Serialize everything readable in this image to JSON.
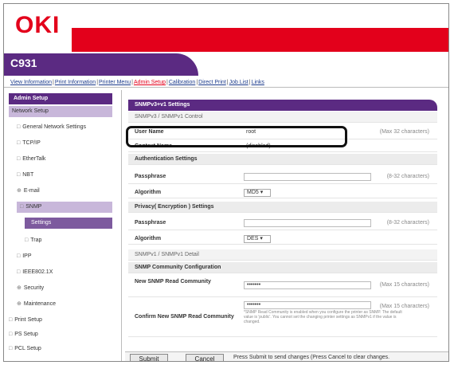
{
  "header": {
    "logo": "OKI",
    "model": "C931"
  },
  "topnav": {
    "items": [
      {
        "label": "View Information"
      },
      {
        "label": "Print Information"
      },
      {
        "label": "Printer Menu"
      },
      {
        "label": "Admin Setup"
      },
      {
        "label": "Calibration"
      },
      {
        "label": "Direct Print"
      },
      {
        "label": "Job List"
      },
      {
        "label": "Links"
      }
    ],
    "sep": "|"
  },
  "sidebar": {
    "title": "Admin Setup",
    "items": [
      {
        "label": "Network Setup"
      },
      {
        "label": "General Network Settings",
        "pre": "□"
      },
      {
        "label": "TCP/IP",
        "pre": "□"
      },
      {
        "label": "EtherTalk",
        "pre": "□"
      },
      {
        "label": "NBT",
        "pre": "□"
      },
      {
        "label": "E-mail",
        "pre": "⊕"
      },
      {
        "label": "SNMP",
        "pre": "□"
      },
      {
        "label": "Settings",
        "pre": ""
      },
      {
        "label": "Trap",
        "pre": "□"
      },
      {
        "label": "IPP",
        "pre": "□"
      },
      {
        "label": "IEEE802.1X",
        "pre": "□"
      },
      {
        "label": "Security",
        "pre": "⊕"
      },
      {
        "label": "Maintenance",
        "pre": "⊕"
      },
      {
        "label": "Print Setup",
        "pre": "□"
      },
      {
        "label": "PS Setup",
        "pre": "□"
      },
      {
        "label": "PCL Setup",
        "pre": "□"
      }
    ]
  },
  "panel": {
    "title": "SNMPv3+v1 Settings",
    "v3_sub": "SNMPv3 / SNMPv1 Control",
    "user_name": {
      "label": "User Name",
      "value": "root",
      "hint": "(Max 32 characters)"
    },
    "context_name": {
      "label": "Context Name",
      "value": "(disabled)"
    },
    "auth_section": "Authentication Settings",
    "auth_pass": {
      "label": "Passphrase",
      "hint": "(8-32 characters)"
    },
    "auth_alg": {
      "label": "Algorithm",
      "value": "MD5 ▾"
    },
    "priv_section": "Privacy( Encryption ) Settings",
    "priv_pass": {
      "label": "Passphrase",
      "hint": "(8-32 characters)"
    },
    "priv_alg": {
      "label": "Algorithm",
      "value": "DES ▾"
    },
    "v1_sub": "SNMPv1 / SNMPv1 Detail",
    "community_section": "SNMP Community Configuration",
    "new_read": {
      "label": "New SNMP Read Community",
      "value": "•••••••",
      "hint": "(Max 15 characters)"
    },
    "confirm_read": {
      "label": "Confirm New SNMP Read Community",
      "value": "•••••••",
      "hint": "(Max 15 characters)",
      "note": "*SNMP Read Community is enabled when you configure the printer as SNMP. The default value is 'public'. You cannot set the changing printer settings as SNMPv1 if the value is changed."
    }
  },
  "footer": {
    "submit": "Submit",
    "cancel": "Cancel",
    "message": "Press Submit to send changes (Press Cancel to clear changes."
  }
}
